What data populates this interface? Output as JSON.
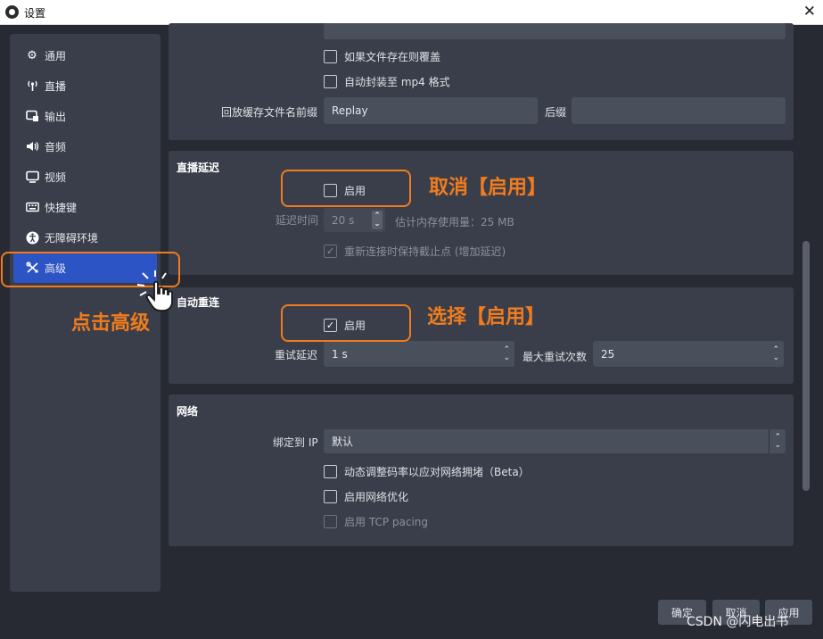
{
  "window": {
    "title": "设置",
    "close_glyph": "✕"
  },
  "sidebar": {
    "items": [
      {
        "label": "通用",
        "icon": "gear-icon",
        "glyph": "⚙"
      },
      {
        "label": "直播",
        "icon": "antenna-icon",
        "glyph": "📶"
      },
      {
        "label": "输出",
        "icon": "output-icon",
        "glyph": "⎚"
      },
      {
        "label": "音频",
        "icon": "speaker-icon",
        "glyph": "🔊"
      },
      {
        "label": "视频",
        "icon": "monitor-icon",
        "glyph": "🖵"
      },
      {
        "label": "快捷键",
        "icon": "keyboard-icon",
        "glyph": "⌨"
      },
      {
        "label": "无障碍环境",
        "icon": "accessibility-icon",
        "glyph": "♿"
      },
      {
        "label": "高级",
        "icon": "tools-icon",
        "glyph": "✂"
      }
    ],
    "active_index": 7
  },
  "recording": {
    "overwrite_label": "如果文件存在则覆盖",
    "autoremux_label": "自动封装至 mp4 格式",
    "replay_prefix_label": "回放缓存文件名前缀",
    "replay_prefix_value": "Replay",
    "suffix_label": "后缀",
    "suffix_value": ""
  },
  "stream_delay": {
    "title": "直播延迟",
    "enable_label": "启用",
    "enabled": false,
    "duration_label": "延迟时间",
    "duration_value": "20 s",
    "memory_label": "估计内存使用量：25 MB",
    "preserve_label": "重新连接时保持截止点 (增加延迟)",
    "preserve_checked": true
  },
  "reconnect": {
    "title": "自动重连",
    "enable_label": "启用",
    "enabled": true,
    "retry_delay_label": "重试延迟",
    "retry_delay_value": "1 s",
    "max_retries_label": "最大重试次数",
    "max_retries_value": "25"
  },
  "network": {
    "title": "网络",
    "bind_ip_label": "绑定到 IP",
    "bind_ip_value": "默认",
    "dynamic_bitrate_label": "动态调整码率以应对网络拥堵（Beta）",
    "network_opt_label": "启用网络优化",
    "tcp_pacing_label": "启用 TCP pacing"
  },
  "annotations": {
    "click_advanced": "点击高级",
    "cancel_enable": "取消【启用】",
    "select_enable": "选择【启用】",
    "accent_color": "#f07c1d"
  },
  "footer": {
    "ok_label": "确定",
    "cancel_label": "取消",
    "apply_label": "应用"
  },
  "watermark": "CSDN @闪电出书",
  "colors": {
    "active": "#2d54c4",
    "background": "#272a33",
    "panel": "#3a3e4a"
  }
}
